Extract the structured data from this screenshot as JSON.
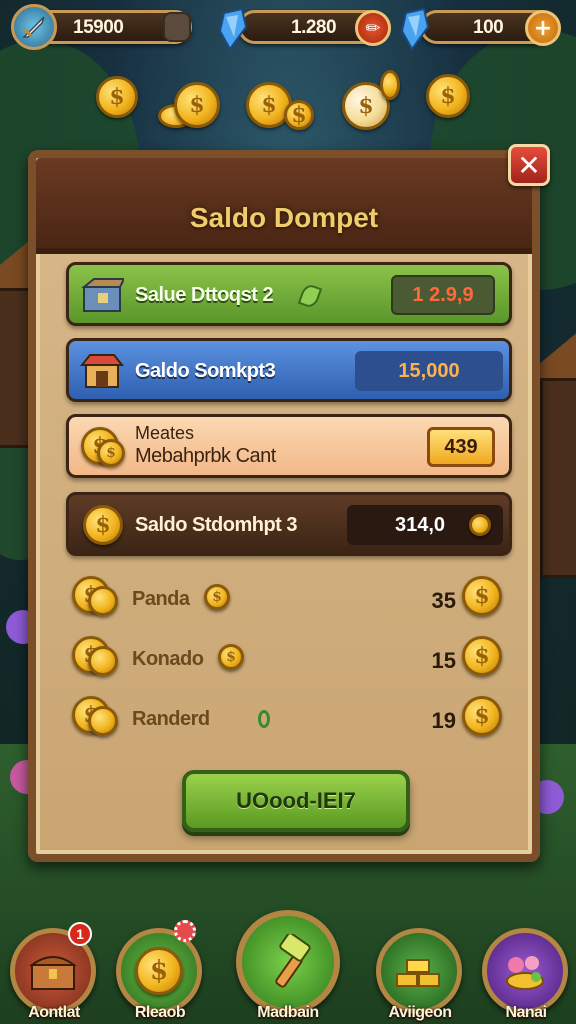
{
  "topbar": {
    "resources": [
      {
        "value": "15900",
        "icon": "sword-icon",
        "action": ""
      },
      {
        "value": "1.280",
        "icon": "blue-gem-icon",
        "action": "✏"
      },
      {
        "value": "100",
        "icon": "blue-gem-icon",
        "action": "+"
      }
    ]
  },
  "panel": {
    "title": "Saldo Dompet",
    "close_label": "✕",
    "rows": [
      {
        "label": "Salue Dttoqst 2",
        "value": "1 2.9,9",
        "icon": "treasure-box-icon"
      },
      {
        "label": "Galdo Somkpt3",
        "value": "15,000",
        "icon": "shop-icon"
      },
      {
        "label_line1": "Meates",
        "label_line2": "Mebahprbk Cant",
        "value": "439",
        "icon": "coin-stack-icon"
      },
      {
        "label": "Saldo Stdomhpt 3",
        "value": "314,0",
        "icon": "coin-icon"
      }
    ],
    "list": [
      {
        "label": "Panda",
        "count": "35"
      },
      {
        "label": "Konado",
        "count": "15"
      },
      {
        "label": "Randerd",
        "count": "19"
      }
    ],
    "action_button": "UOood-IEI7"
  },
  "bottomnav": {
    "items": [
      {
        "label": "Aontlat",
        "icon": "chest-icon",
        "badge": "1"
      },
      {
        "label": "Rleaob",
        "icon": "coin-icon",
        "badge": ""
      },
      {
        "label": "Madbain",
        "icon": "hammer-icon",
        "badge": ""
      },
      {
        "label": "Aviigeon",
        "icon": "gold-bars-icon",
        "badge": ""
      },
      {
        "label": "Nanai",
        "icon": "flower-basket-icon",
        "badge": ""
      }
    ]
  },
  "colors": {
    "gold": "#f2b41e",
    "panel_wood": "#7a4f2a",
    "green_row": "#6aa336",
    "blue_row": "#3a6fc2",
    "peach_row": "#f6c9a0",
    "dark_row": "#4a2e1c",
    "close_red": "#d23a2a"
  }
}
